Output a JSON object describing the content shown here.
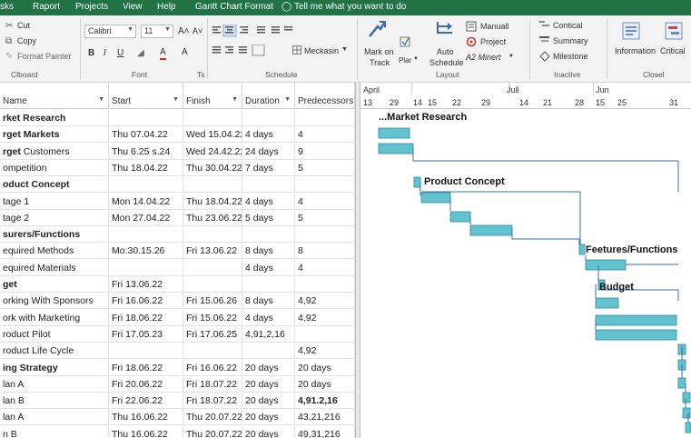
{
  "tabs": [
    "sks",
    "Raport",
    "Projects",
    "View",
    "Help",
    "Gantt Chart Format"
  ],
  "tell_me": "Tell me what you want to do",
  "clipboard": {
    "cut": "Cut",
    "copy": "Copy",
    "format_painter": "Format Painter",
    "group_label": "Clboard"
  },
  "font": {
    "family": "Calibri",
    "size": "11",
    "grow": "A˄",
    "shrink": "A˅",
    "bold": "B",
    "italic": "I",
    "underline": "U",
    "group_label": "Font",
    "ts_label": "Ts"
  },
  "schedule": {
    "meckasin": "Meckasin",
    "group_label": "Schedule"
  },
  "tasks_group": {
    "mark_on_track_1": "Mark on",
    "mark_on_track_2": "Track",
    "plan": "Plar",
    "auto_schedule_1": "Auto",
    "auto_schedule_2": "Schedule",
    "manual": "Manuall",
    "project": "Project",
    "minert": "A2 Minert",
    "group_label": "Layout"
  },
  "insert_group": {
    "contical": "Contical",
    "summary": "Summary",
    "milestone": "Milestone",
    "group_label": "Inactive"
  },
  "properties_group": {
    "information": "Information",
    "critical": "Critical",
    "group_label": "Closel"
  },
  "columns": {
    "name": "Name",
    "start": "Start",
    "finish": "Finish",
    "duration": "Duration",
    "predecessors": "Predecessors"
  },
  "rows": [
    {
      "name": "rket Research",
      "start": "",
      "finish": "",
      "duration": "",
      "pred": "",
      "summary": true
    },
    {
      "name": "rget Markets",
      "start": "Thu 07.04.22",
      "finish": "Wed 15.04.22",
      "duration": "4 days",
      "pred": "4",
      "summary": true
    },
    {
      "name": "rget Customers",
      "start": "Thu 6.25 s.24",
      "finish": "Wed 24.42.22",
      "duration": "24 days",
      "pred": "9",
      "summary": false,
      "partial_bold": "rget"
    },
    {
      "name": "ompetition",
      "start": "Thu 18.04.22",
      "finish": "Thu 30.04.22",
      "duration": "7 days",
      "pred": "5",
      "summary": false
    },
    {
      "name": "oduct Concept",
      "start": "",
      "finish": "",
      "duration": "",
      "pred": "",
      "summary": true
    },
    {
      "name": "tage 1",
      "start": "Mon 14.04.22",
      "finish": "Thu 18.04.22",
      "duration": "4 days",
      "pred": "4",
      "summary": false
    },
    {
      "name": "tage 2",
      "start": "Mon 27.04.22",
      "finish": "Thu 23.06.22",
      "duration": "5 days",
      "pred": "5",
      "summary": false
    },
    {
      "name": "surers/Functions",
      "start": "",
      "finish": "",
      "duration": "",
      "pred": "",
      "summary": true
    },
    {
      "name": "equired Methods",
      "start": "Mo:30.15.26",
      "finish": "Fri 13.06.22",
      "duration": "8 days",
      "pred": "8",
      "summary": false
    },
    {
      "name": "equired Materials",
      "start": "",
      "finish": "",
      "duration": "4 days",
      "pred": "4",
      "summary": false
    },
    {
      "name": "get",
      "start": "Fri 13.06.22",
      "finish": "",
      "duration": "",
      "pred": "",
      "summary": true
    },
    {
      "name": "orking With Sponsors",
      "start": "Fri 16.06.22",
      "finish": "Fri 15.06.26",
      "duration": "8 days",
      "pred": "4,92",
      "summary": false
    },
    {
      "name": "ork with Marketing",
      "start": "Fri 18.06.22",
      "finish": "Fri 15.06.22",
      "duration": "4 days",
      "pred": "4,92",
      "summary": false
    },
    {
      "name": "roduct Pilot",
      "start": "Fri 17.05.23",
      "finish": "Fri 17.06.25",
      "duration": "4,91,2,16",
      "pred": "",
      "summary": false
    },
    {
      "name": "roduct Life Cycle",
      "start": "",
      "finish": "",
      "duration": "",
      "pred": "4,92",
      "summary": false
    },
    {
      "name": "ing Strategy",
      "start": "Fri 18.06.22",
      "finish": "Fri 16.06.22",
      "duration": "20 days",
      "pred": "20 days",
      "summary": true
    },
    {
      "name": "lan A",
      "start": "Fri 20.06.22",
      "finish": "Fri 18.07.22",
      "duration": "20 days",
      "pred": "20 days",
      "summary": false
    },
    {
      "name": "lan B",
      "start": "Fri 22.06.22",
      "finish": "Fri 18.07.22",
      "duration": "20 days",
      "pred": "4,91.2,16",
      "summary": false,
      "pred_bold": true
    },
    {
      "name": "lan A",
      "start": "Thu 16.06.22",
      "finish": "Thu 20.07.22",
      "duration": "20 days",
      "pred": "43,21,216",
      "summary": false
    },
    {
      "name": "n B",
      "start": "Thu 16.06.22",
      "finish": "Thu 20.07.22",
      "duration": "20 days",
      "pred": "49,31,216",
      "summary": false
    }
  ],
  "timescale": {
    "months": [
      "April",
      "Jull",
      "Jun"
    ],
    "days": [
      "13",
      "29",
      "14",
      "15",
      "22",
      "29",
      "14",
      "21",
      "28",
      "15",
      "25",
      "31"
    ]
  },
  "gantt_labels": {
    "market_research": "...Market Research",
    "product_concept": "Product Concept",
    "features_functions": "Feetures/Functions",
    "budget": "Budget"
  },
  "colors": {
    "tabbar": "#217346",
    "bar_fill": "#62c2cf",
    "bar_stroke": "#2e8a9b",
    "link": "#3a6fa8"
  }
}
